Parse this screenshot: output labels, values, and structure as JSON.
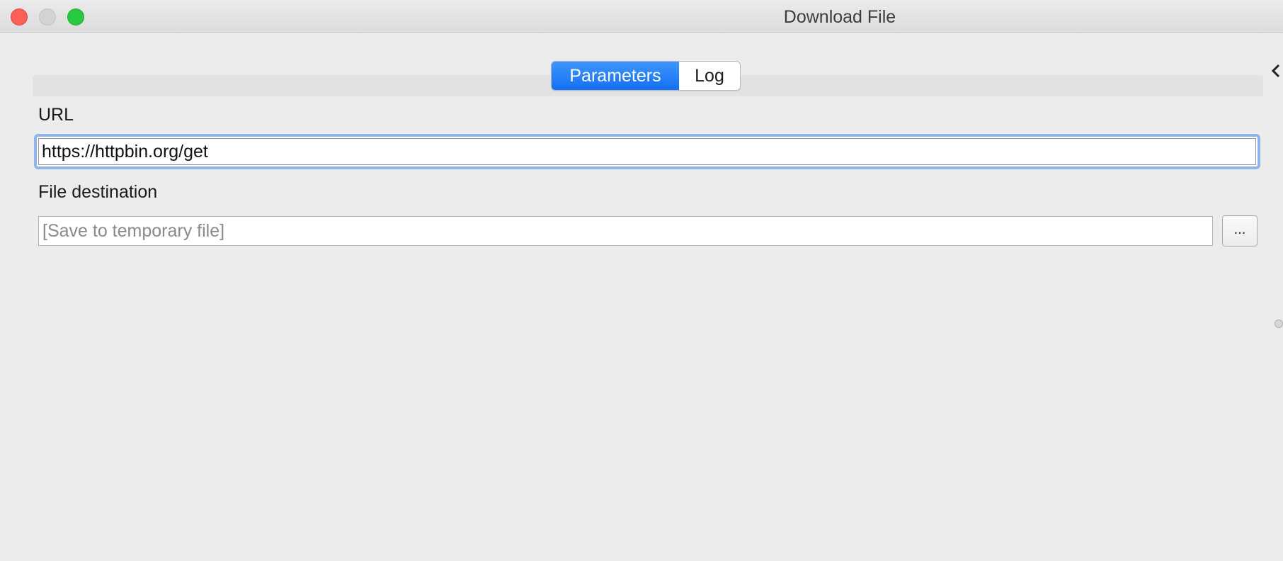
{
  "window": {
    "title": "Download File"
  },
  "tabs": [
    {
      "label": "Parameters",
      "active": true
    },
    {
      "label": "Log",
      "active": false
    }
  ],
  "fields": {
    "url": {
      "label": "URL",
      "value": "https://httpbin.org/get"
    },
    "destination": {
      "label": "File destination",
      "value": "",
      "placeholder": "[Save to temporary file]",
      "browse_label": "..."
    }
  },
  "colors": {
    "accent": "#1570f4",
    "focus_ring": "#8fb4e9",
    "close": "#fe5f57",
    "maximize": "#28c940"
  },
  "icons": {
    "side_toggle": "chevron-left-icon"
  }
}
